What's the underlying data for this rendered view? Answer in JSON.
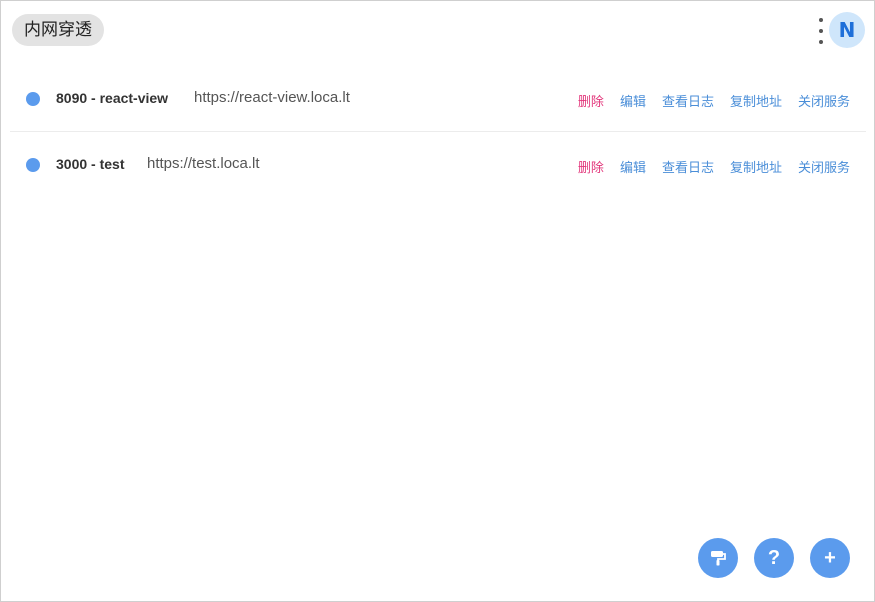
{
  "header": {
    "title": "内网穿透",
    "avatar_letter": "N"
  },
  "services": [
    {
      "name": "8090 - react-view",
      "url": "https://react-view.loca.lt",
      "status_color": "#5b9bed",
      "actions": [
        "删除",
        "编辑",
        "查看日志",
        "复制地址",
        "关闭服务"
      ]
    },
    {
      "name": "3000 - test",
      "url": "https://test.loca.lt",
      "status_color": "#5b9bed",
      "actions": [
        "删除",
        "编辑",
        "查看日志",
        "复制地址",
        "关闭服务"
      ]
    }
  ],
  "fabs": {
    "help_label": "?",
    "add_label": "+",
    "theme_icon": "paint-roller-icon"
  },
  "colors": {
    "accent": "#5b9bed",
    "delete": "#e2357a",
    "link": "#4a8ed8"
  }
}
